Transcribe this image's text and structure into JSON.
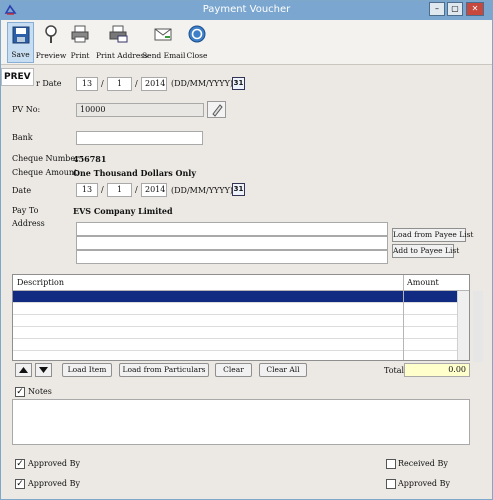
{
  "window": {
    "title": "Payment Voucher",
    "min": "–",
    "max": "▢",
    "close": "✕"
  },
  "toolbar": {
    "save": "Save",
    "preview": "Preview",
    "print": "Print",
    "print_address": "Print Address",
    "send_email": "Send Email",
    "close": "Close"
  },
  "badge": "PREV",
  "form": {
    "voucher_date_label": "r Date",
    "voucher_date": {
      "day": "13",
      "month": "1",
      "year": "2014",
      "format": "(DD/MM/YYYY)"
    },
    "pv_no_label": "PV No:",
    "pv_no": "10000",
    "bank_label": "Bank",
    "bank": "",
    "cheque_number_label": "Cheque Number",
    "cheque_number": "456781",
    "cheque_amount_label": "Cheque Amount",
    "cheque_amount": "One Thousand Dollars Only",
    "date_label": "Date",
    "date": {
      "day": "13",
      "month": "1",
      "year": "2014",
      "format": "(DD/MM/YYYY)"
    },
    "pay_to_label": "Pay To",
    "pay_to": "EVS Company Limited",
    "address_label": "Address",
    "calendar_glyph": "31",
    "slash": "/"
  },
  "buttons": {
    "load_from_payee": "Load from Payee List",
    "add_to_payee": "Add to Payee List",
    "load_item": "Load Item",
    "load_from_particulars": "Load from Particulars",
    "clear": "Clear",
    "clear_all": "Clear All"
  },
  "grid": {
    "col_description": "Description",
    "col_amount": "Amount",
    "total_label": "Total",
    "total_value": "0.00"
  },
  "notes_label": "Notes",
  "approvals": {
    "approved_by_1": "Approved By",
    "approved_by_2": "Approved By",
    "received_by": "Received By",
    "approved_by_3": "Approved By",
    "check": "✓"
  }
}
